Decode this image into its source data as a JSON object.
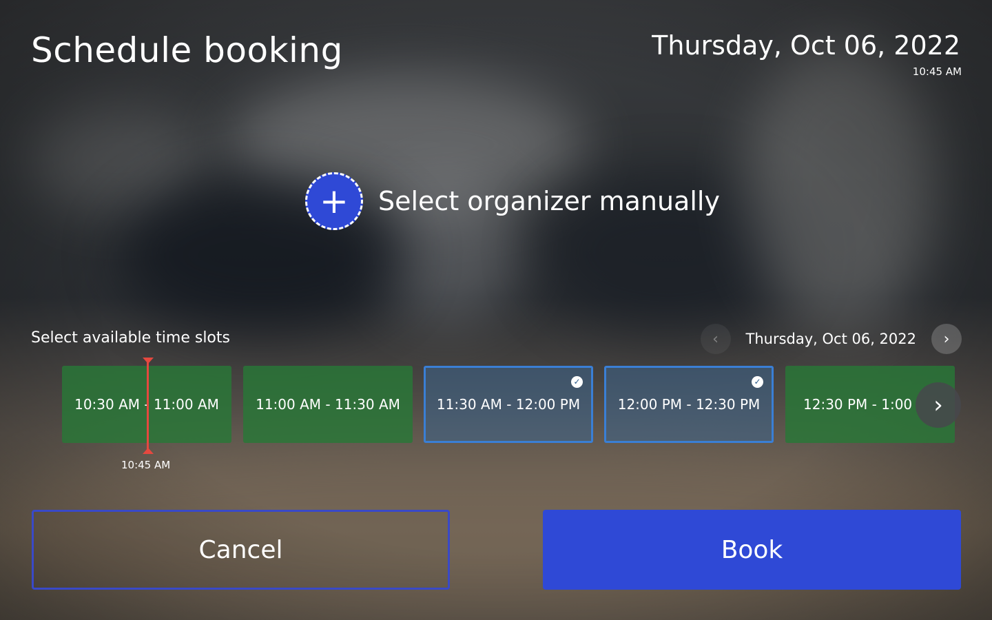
{
  "header": {
    "title": "Schedule booking",
    "date": "Thursday, Oct 06, 2022",
    "time": "10:45 AM"
  },
  "organizer": {
    "icon": "plus-icon",
    "label": "Select organizer manually"
  },
  "slots_section": {
    "label": "Select available time slots",
    "date": "Thursday, Oct 06, 2022",
    "prev_icon": "chevron-left-icon",
    "next_icon": "chevron-right-icon",
    "current_time": "10:45 AM",
    "slots": [
      {
        "label": "10:30 AM - 11:00 AM",
        "state": "available"
      },
      {
        "label": "11:00 AM - 11:30 AM",
        "state": "available"
      },
      {
        "label": "11:30 AM - 12:00 PM",
        "state": "selected"
      },
      {
        "label": "12:00 PM - 12:30 PM",
        "state": "selected"
      },
      {
        "label": "12:30 PM - 1:00",
        "state": "available"
      }
    ]
  },
  "colors": {
    "accent": "#2f49d6",
    "available": "#287837",
    "selected_border": "#3a7fd5",
    "now_line": "#e5483f"
  },
  "actions": {
    "cancel": "Cancel",
    "book": "Book"
  }
}
